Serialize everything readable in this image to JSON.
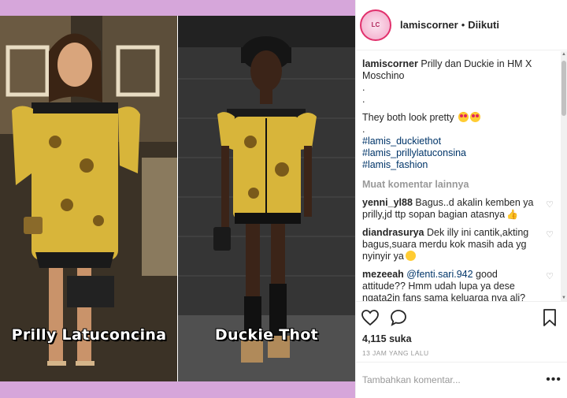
{
  "post_image": {
    "left_caption": "Prilly Latuconcina",
    "right_caption": "Duckie Thot"
  },
  "header": {
    "username": "lamiscorner",
    "separator": "•",
    "follow_status": "Diikuti"
  },
  "caption": {
    "username": "lamiscorner",
    "line1": "Prilly dan Duckie in HM X Moschino",
    "dot1": ".",
    "dot2": ".",
    "line2": "They both look pretty",
    "dot3": ".",
    "tags": [
      "#lamis_duckiethot",
      "#lamis_prillylatuconsina",
      "#lamis_fashion"
    ]
  },
  "more_comments_label": "Muat komentar lainnya",
  "comments": [
    {
      "user": "yenni_yl88",
      "text": "Bagus..d akalin kemben ya prilly,jd ttp sopan bagian atasnya"
    },
    {
      "user": "diandrasurya",
      "text": "Dek illy ini cantik,akting bagus,suara merdu kok masih ada yg nyinyir ya"
    },
    {
      "user": "mezeeah",
      "mention": "@fenti.sari.942",
      "text": "good attitude?? Hmm udah lupa ya dese ngata2in fans sama keluarga nya ali?"
    }
  ],
  "likes": "4,115 suka",
  "timestamp": "13 JAM YANG LALU",
  "add_comment": {
    "placeholder": "Tambahkan komentar...",
    "more": "•••"
  },
  "colors": {
    "accent_tag": "#003569",
    "border": "#efefef",
    "muted": "#999999",
    "frame": "#d6a6da"
  },
  "icons": [
    "heart-icon",
    "comment-icon",
    "bookmark-icon",
    "more-options-icon"
  ]
}
